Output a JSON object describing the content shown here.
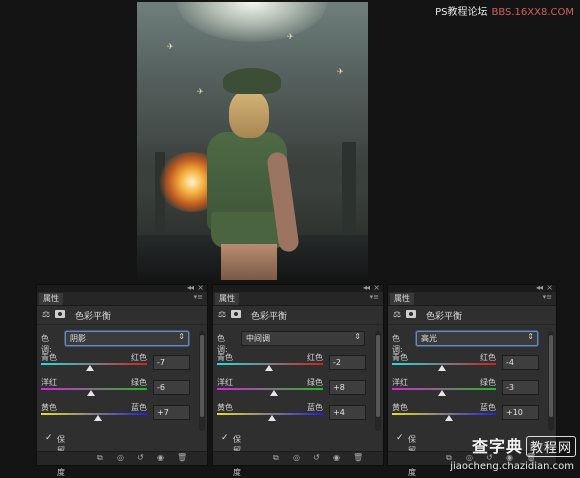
{
  "watermark_top": {
    "text": "PS教程论坛",
    "site": "BBS.16XX8.COM"
  },
  "watermark_bottom": {
    "brand": "查字典",
    "box": "教程网",
    "url": "jiaocheng.chazidian.com"
  },
  "panels": [
    {
      "tab": "属性",
      "title": "色彩平衡",
      "tone_label": "色调:",
      "tone_value": "阴影",
      "tone_focused": true,
      "sliders": [
        {
          "left": "青色",
          "right": "红色",
          "value": "-7",
          "level": -7,
          "track": "t-cyan"
        },
        {
          "left": "洋红",
          "right": "绿色",
          "value": "-6",
          "level": -6,
          "track": "t-mag"
        },
        {
          "left": "黄色",
          "right": "蓝色",
          "value": "+7",
          "level": 7,
          "track": "t-yel"
        }
      ],
      "preserve_label": "保留明度",
      "preserve_checked": true
    },
    {
      "tab": "属性",
      "title": "色彩平衡",
      "tone_label": "色调:",
      "tone_value": "中间调",
      "tone_focused": false,
      "sliders": [
        {
          "left": "青色",
          "right": "红色",
          "value": "-2",
          "level": -2,
          "track": "t-cyan"
        },
        {
          "left": "洋红",
          "right": "绿色",
          "value": "+8",
          "level": 8,
          "track": "t-mag"
        },
        {
          "left": "黄色",
          "right": "蓝色",
          "value": "+4",
          "level": 4,
          "track": "t-yel"
        }
      ],
      "preserve_label": "保留明度",
      "preserve_checked": true
    },
    {
      "tab": "属性",
      "title": "色彩平衡",
      "tone_label": "色调:",
      "tone_value": "高光",
      "tone_focused": true,
      "sliders": [
        {
          "left": "青色",
          "right": "红色",
          "value": "-4",
          "level": -4,
          "track": "t-cyan"
        },
        {
          "left": "洋红",
          "right": "绿色",
          "value": "-3",
          "level": -3,
          "track": "t-mag"
        },
        {
          "left": "黄色",
          "right": "蓝色",
          "value": "+10",
          "level": 10,
          "track": "t-yel"
        }
      ],
      "preserve_label": "保留明度",
      "preserve_checked": true
    }
  ],
  "icons": {
    "balance": "scale-icon",
    "mask": "mask-icon",
    "check": "checkmark-icon",
    "bottom": [
      "clip-icon",
      "view-previous-icon",
      "reset-icon",
      "visibility-icon",
      "trash-icon"
    ]
  }
}
